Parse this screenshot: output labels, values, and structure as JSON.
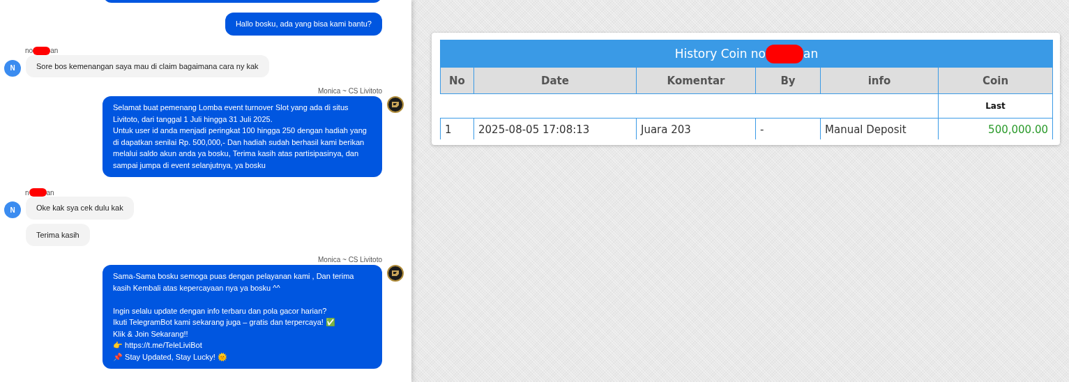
{
  "chat": {
    "messages": [
      {
        "kind": "clipped"
      },
      {
        "kind": "agent",
        "bubbles": [
          "Hallo bosku, ada yang bisa kami bantu?"
        ]
      },
      {
        "kind": "user",
        "sender": {
          "start": "no",
          "end": "an",
          "redacted": true
        },
        "avatar": "N",
        "bubbles": [
          "Sore bos kemenangan saya mau di claim bagaimana cara ny kak"
        ]
      },
      {
        "kind": "agent",
        "sender": "Monica ~ CS Livitoto",
        "avatar": true,
        "bubbles": [
          "Selamat buat pemenang Lomba event turnover Slot yang ada di situs Livitoto, dari tanggal 1 Juli hingga 31 Juli 2025.\nUntuk user id anda menjadi peringkat 100 hingga 250 dengan hadiah yang di dapatkan senilai Rp. 500,000,- Dan hadiah sudah berhasil kami berikan melalui saldo akun anda ya bosku, Terima kasih atas partisipasinya, dan sampai jumpa di event selanjutnya, ya bosku"
        ]
      },
      {
        "kind": "user",
        "sender": {
          "start": "n",
          "end": "an",
          "redacted": true
        },
        "avatar": "N",
        "bubbles": [
          "Oke kak sya cek dulu kak",
          "Terima kasih"
        ]
      },
      {
        "kind": "agent",
        "sender": "Monica ~ CS Livitoto",
        "avatar": true,
        "bubbles": [
          "Sama-Sama bosku semoga puas dengan pelayanan kami , Dan terima kasih Kembali atas kepercayaan nya ya bosku ^^\n\nIngin selalu update dengan info terbaru dan pola gacor harian?\nIkuti TelegramBot kami sekarang juga – gratis dan terpercaya! ✅\nKlik & Join Sekarang!!\n👉 https://t.me/TeleLiviBot\n📌 Stay Updated, Stay Lucky! 🌞"
        ]
      }
    ]
  },
  "coin_history": {
    "title": {
      "start": "History Coin no",
      "end": "an",
      "redacted": true
    },
    "columns": [
      "No",
      "Date",
      "Komentar",
      "By",
      "info",
      "Coin"
    ],
    "subheader": "Last",
    "rows": [
      {
        "cells": [
          "1",
          "2025-08-05 17:08:13",
          "Juara 203",
          "-",
          "Manual Deposit",
          "500,000.00"
        ]
      }
    ]
  }
}
